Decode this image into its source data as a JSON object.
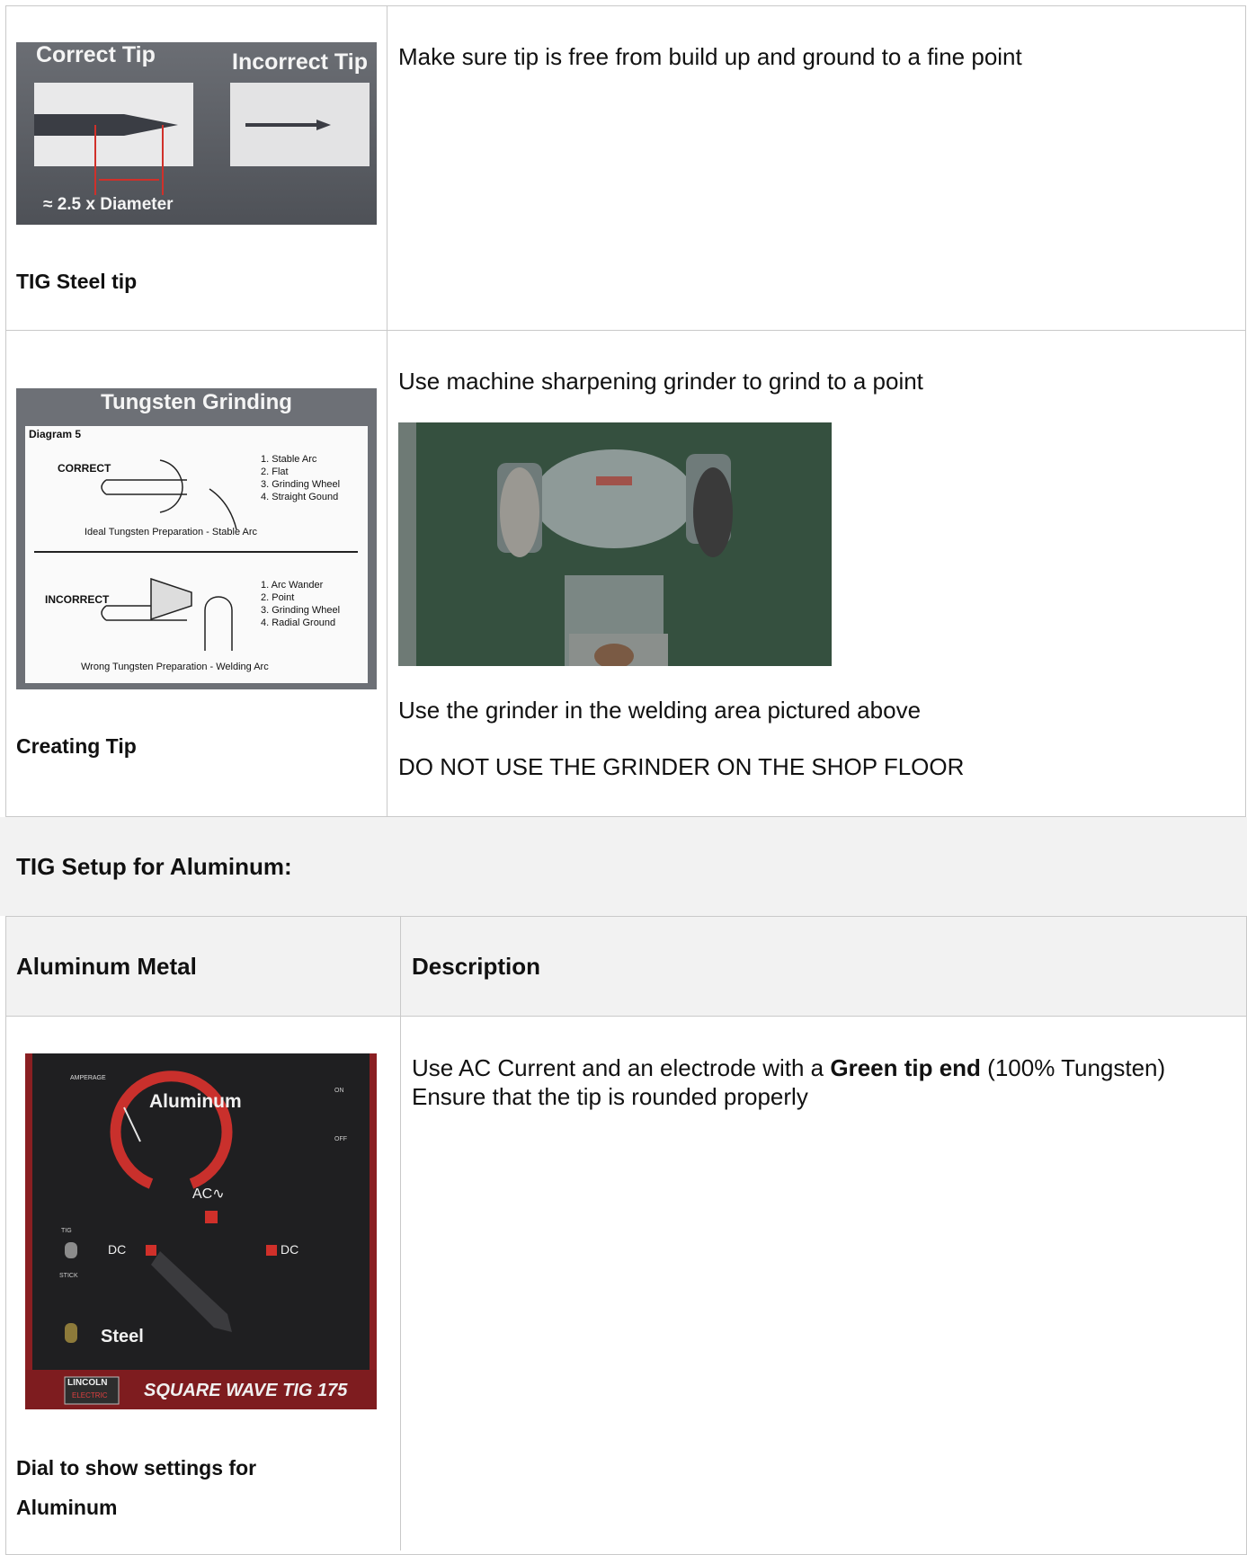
{
  "steel_tip_row": {
    "image": {
      "correct_label": "Correct Tip",
      "incorrect_label": "Incorrect Tip",
      "dimension_label": "≈ 2.5 x Diameter"
    },
    "caption": "TIG Steel tip",
    "description": "Make sure tip is free from build up and ground to a fine point"
  },
  "creating_tip_row": {
    "image": {
      "title": "Tungsten Grinding",
      "diagram_label": "Diagram 5",
      "correct_label": "CORRECT",
      "correct_items": [
        "1. Stable Arc",
        "2. Flat",
        "3. Grinding Wheel",
        "4. Straight Gound"
      ],
      "correct_caption": "Ideal Tungsten Preparation - Stable Arc",
      "incorrect_label": "INCORRECT",
      "incorrect_items": [
        "1. Arc Wander",
        "2. Point",
        "3. Grinding Wheel",
        "4. Radial Ground"
      ],
      "incorrect_caption": "Wrong Tungsten Preparation - Welding Arc"
    },
    "caption": "Creating Tip",
    "description_top": "Use machine sharpening grinder to grind to a point",
    "description_mid": "Use the grinder in the welding area pictured above",
    "description_bottom": "DO NOT USE THE GRINDER ON THE SHOP FLOOR"
  },
  "aluminum_section": {
    "heading": "TIG Setup for Aluminum:",
    "col1_header": "Aluminum Metal",
    "col2_header": "Description",
    "image": {
      "amperage_label": "AMPERAGE",
      "aluminum_label": "Aluminum",
      "ac_label": "AC∿",
      "dc_label": "DC",
      "tig_label": "TIG",
      "stick_label": "STICK",
      "on_label": "ON",
      "off_label": "OFF",
      "steel_label": "Steel",
      "brand": "LINCOLN",
      "brand_sub": "ELECTRIC",
      "model": "SQUARE WAVE TIG 175"
    },
    "caption_line1": "Dial to show settings for",
    "caption_line2": "Aluminum",
    "desc_part1": "Use AC Current and an electrode with a ",
    "desc_bold": "Green tip end",
    "desc_part2": " (100% Tungsten)",
    "desc_line2": "Ensure that the tip is rounded properly"
  },
  "colors": {
    "border": "#c9c9c9",
    "band_bg": "#f2f2f2",
    "accent_red": "#d0302a"
  }
}
